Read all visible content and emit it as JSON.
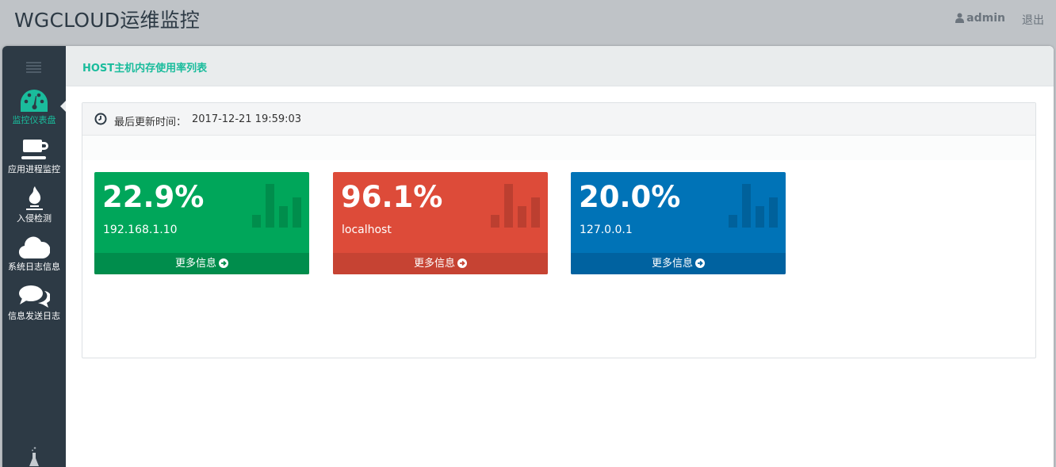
{
  "header": {
    "app_title": "WGCLOUD运维监控",
    "user": "admin",
    "logout": "退出"
  },
  "sidebar": {
    "items": [
      {
        "label": "监控仪表盘",
        "icon": "dashboard-icon",
        "active": true
      },
      {
        "label": "应用进程监控",
        "icon": "coffee-cup-icon",
        "active": false
      },
      {
        "label": "入侵检测",
        "icon": "fire-icon",
        "active": false
      },
      {
        "label": "系统日志信息",
        "icon": "cloud-icon",
        "active": false
      },
      {
        "label": "信息发送日志",
        "icon": "chat-bubbles-icon",
        "active": false
      }
    ],
    "bottom_icon": "flask-icon"
  },
  "page": {
    "title": "HOST主机内存使用率列表"
  },
  "panel": {
    "update_label": "最后更新时间：",
    "update_time": "2017-12-21 19:59:03"
  },
  "cards": [
    {
      "percent": "22.9%",
      "host": "192.168.1.10",
      "more": "更多信息",
      "color": "#00a65a"
    },
    {
      "percent": "96.1%",
      "host": "localhost",
      "more": "更多信息",
      "color": "#dd4b39"
    },
    {
      "percent": "20.0%",
      "host": "127.0.0.1",
      "more": "更多信息",
      "color": "#0073b7"
    }
  ],
  "colors": {
    "accent": "#1abc9c",
    "sidebar": "#2d3a45",
    "topbar": "#bfc3c7"
  }
}
